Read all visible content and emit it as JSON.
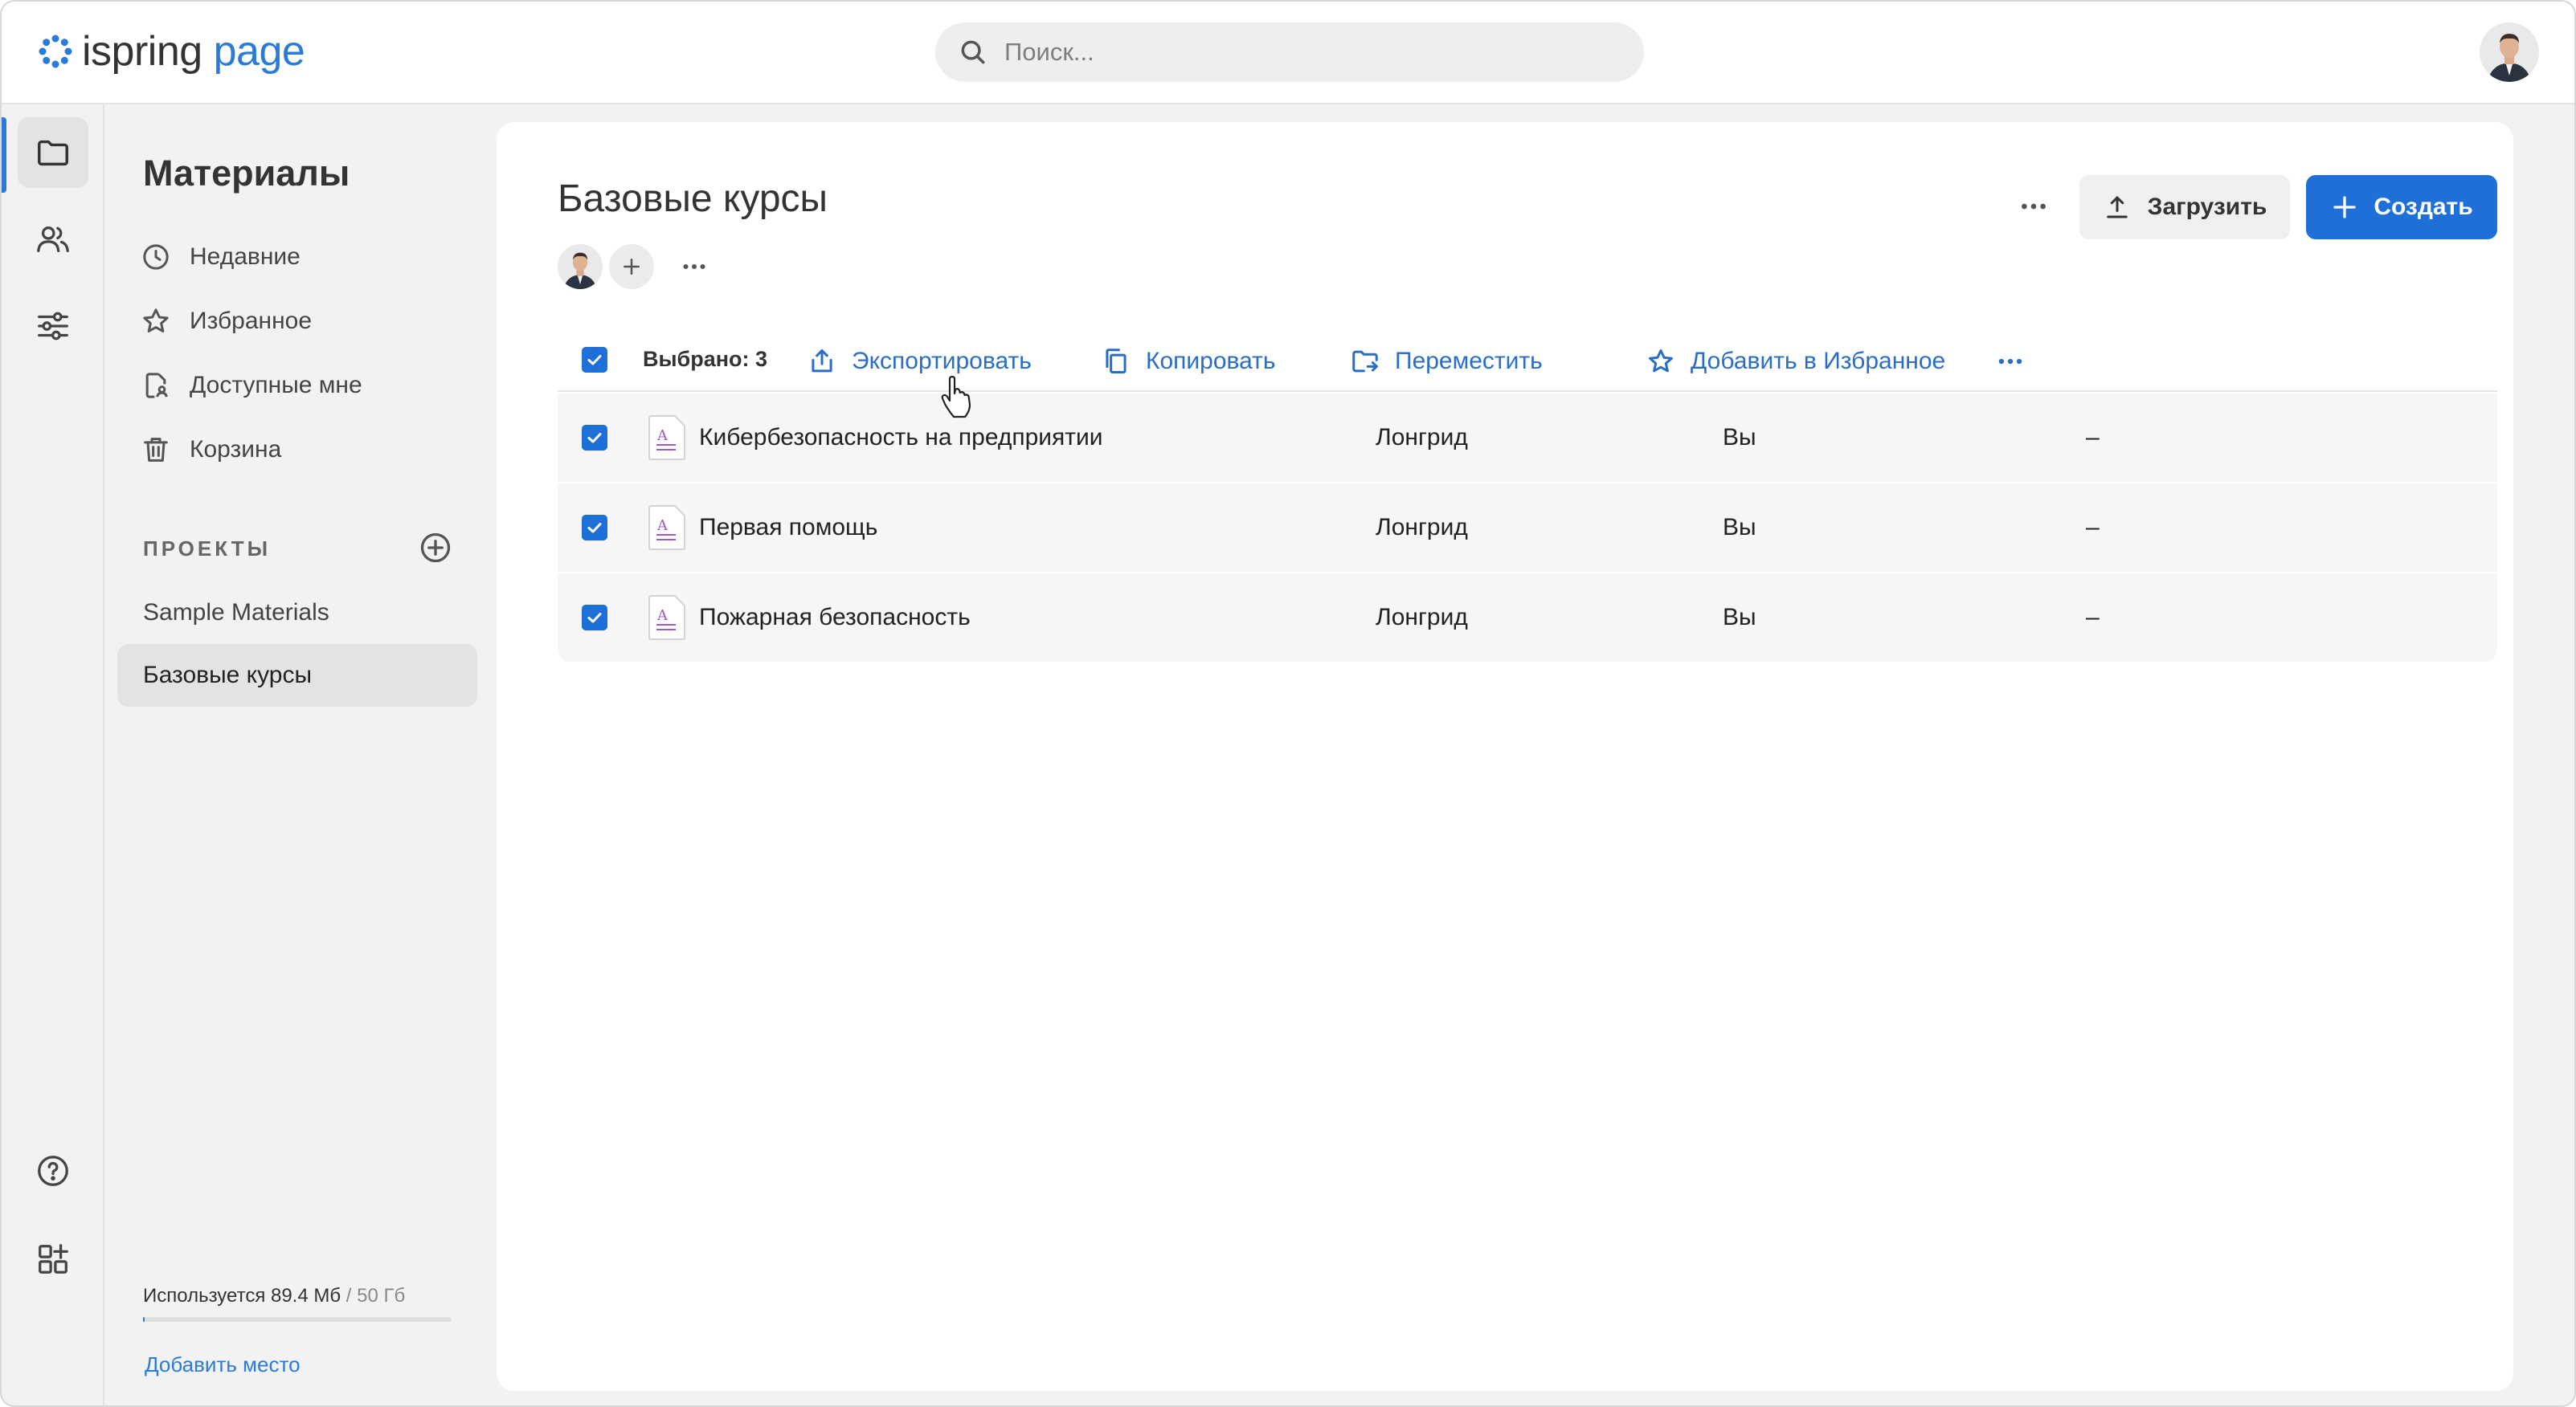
{
  "topbar": {
    "logo_ispring": "ispring",
    "logo_page": "page",
    "search_placeholder": "Поиск..."
  },
  "sidebar": {
    "title": "Материалы",
    "items": [
      {
        "label": "Недавние",
        "icon": "clock-icon"
      },
      {
        "label": "Избранное",
        "icon": "star-icon"
      },
      {
        "label": "Доступные мне",
        "icon": "shared-doc-icon"
      },
      {
        "label": "Корзина",
        "icon": "trash-icon"
      }
    ],
    "projects_label": "ПРОЕКТЫ",
    "projects": [
      {
        "label": "Sample Materials",
        "active": false
      },
      {
        "label": "Базовые курсы",
        "active": true
      }
    ],
    "usage_text": "Используется 89.4 Мб",
    "usage_total": " / 50 Гб",
    "usage_fraction": 0.002,
    "add_space": "Добавить место"
  },
  "main": {
    "title": "Базовые курсы",
    "upload_label": "Загрузить",
    "create_label": "Создать",
    "selection": {
      "count_label": "Выбрано: 3",
      "actions": {
        "export": "Экспортировать",
        "copy": "Копировать",
        "move": "Переместить",
        "favorite": "Добавить в Избранное"
      }
    },
    "rows": [
      {
        "name": "Кибербезопасность на предприятии",
        "type": "Лонгрид",
        "owner": "Вы",
        "date": "–"
      },
      {
        "name": "Первая помощь",
        "type": "Лонгрид",
        "owner": "Вы",
        "date": "–"
      },
      {
        "name": "Пожарная безопасность",
        "type": "Лонгрид",
        "owner": "Вы",
        "date": "–"
      }
    ]
  },
  "colors": {
    "accent": "#1f6fd8",
    "link": "#2a6dc8",
    "doc_icon_purple": "#9b59d0"
  }
}
